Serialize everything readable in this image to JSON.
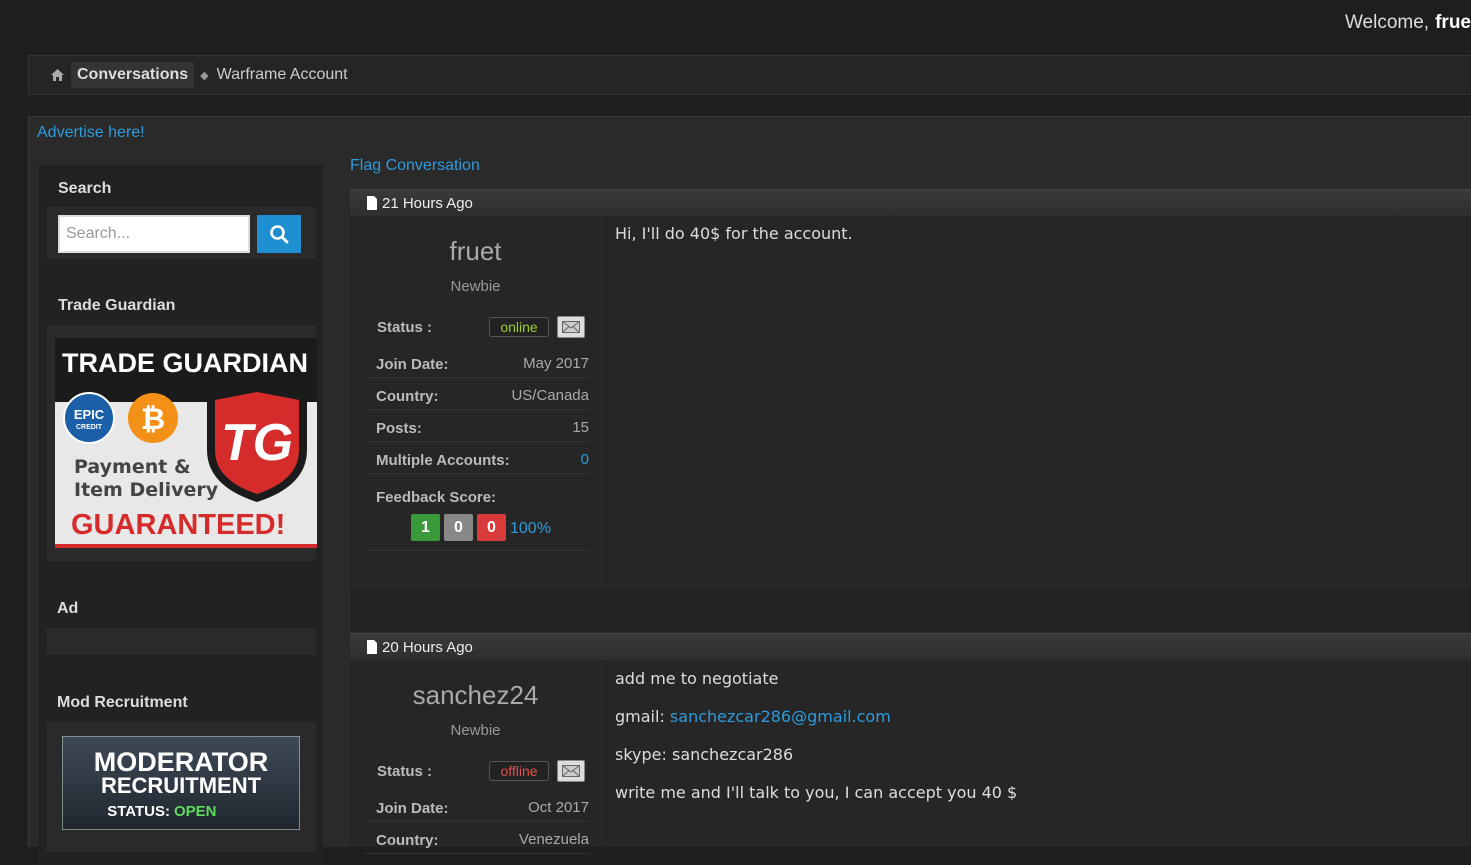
{
  "header": {
    "welcome": "Welcome,",
    "username": "frue"
  },
  "breadcrumb": {
    "home_icon": "home-icon",
    "section": "Conversations",
    "current": "Warframe Account"
  },
  "advertise_link": "Advertise here!",
  "sidebar": {
    "search_title": "Search",
    "search_placeholder": "Search...",
    "trade_guardian_title": "Trade Guardian",
    "trade_guardian_banner": {
      "headline": "TRADE GUARDIAN",
      "epic_line1": "EPIC",
      "epic_line2": "CREDIT",
      "line1": "Payment &",
      "line2": "Item Delivery",
      "guaranteed": "GUARANTEED!",
      "logo": "TG"
    },
    "ad_title": "Ad",
    "mod_title": "Mod Recruitment",
    "mod_banner": {
      "line1": "MODERATOR",
      "line2": "RECRUITMENT",
      "status_label": "STATUS:",
      "status_value": "OPEN"
    }
  },
  "flag_link": "Flag Conversation",
  "posts": [
    {
      "time": "21 Hours Ago",
      "username": "fruet",
      "rank": "Newbie",
      "status_label": "Status :",
      "status": "online",
      "join_label": "Join Date:",
      "join": "May 2017",
      "country_label": "Country:",
      "country": "US/Canada",
      "posts_label": "Posts:",
      "posts": "15",
      "multi_label": "Multiple Accounts:",
      "multi": "0",
      "feedback_label": "Feedback Score:",
      "feedback": {
        "positive": "1",
        "neutral": "0",
        "negative": "0",
        "percent": "100%"
      },
      "message": "Hi, I'll do 40$ for the account."
    },
    {
      "time": "20 Hours Ago",
      "username": "sanchez24",
      "rank": "Newbie",
      "status_label": "Status :",
      "status": "offline",
      "join_label": "Join Date:",
      "join": "Oct 2017",
      "country_label": "Country:",
      "country": "Venezuela",
      "lines": {
        "l1": "add me to negotiate",
        "gmail_label": "gmail:",
        "gmail": "sanchezcar286@gmail.com",
        "l3": "skype: sanchezcar286",
        "l4": "write me and I'll talk to you, I can accept you 40 $"
      }
    }
  ],
  "colors": {
    "link": "#2e9bdd",
    "online": "#9acd32",
    "offline": "#e05050",
    "fb_positive": "#3a9a3a",
    "fb_neutral": "#888888",
    "fb_negative": "#d93b3b",
    "search_button": "#1e8fd0"
  }
}
